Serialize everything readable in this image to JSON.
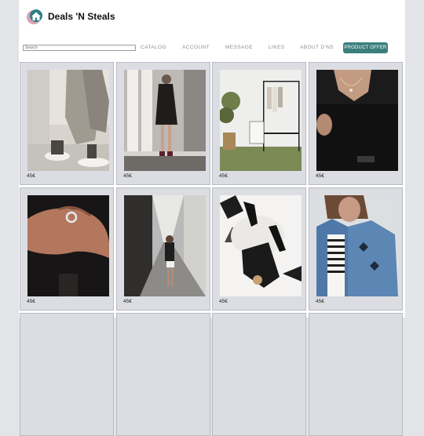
{
  "header": {
    "brand_name": "Deals 'N Steals"
  },
  "search": {
    "placeholder": "Search"
  },
  "nav": {
    "catalog": "CATALOG",
    "account": "ACCOUNT",
    "message": "MESSAGE",
    "likes": "LIKES",
    "about": "ABOUT D'NS",
    "product_offer": "PRODUCT OFFER"
  },
  "products": [
    {
      "price": "45€",
      "image": "sneakers-wide-trousers-photo"
    },
    {
      "price": "45€",
      "image": "woman-black-outfit-columns-photo"
    },
    {
      "price": "45€",
      "image": "clothing-rack-room-photo"
    },
    {
      "price": "45€",
      "image": "necklace-black-top-photo"
    },
    {
      "price": "45€",
      "image": "ring-hand-photo"
    },
    {
      "price": "45€",
      "image": "woman-walking-street-photo"
    },
    {
      "price": "45€",
      "image": "black-heels-fur-rug-photo"
    },
    {
      "price": "45€",
      "image": "denim-jacket-striped-shirt-photo"
    }
  ],
  "colors": {
    "accent": "#3a7f7c",
    "card_bg": "#dcdde3",
    "page_bg": "#e3e4e8"
  }
}
